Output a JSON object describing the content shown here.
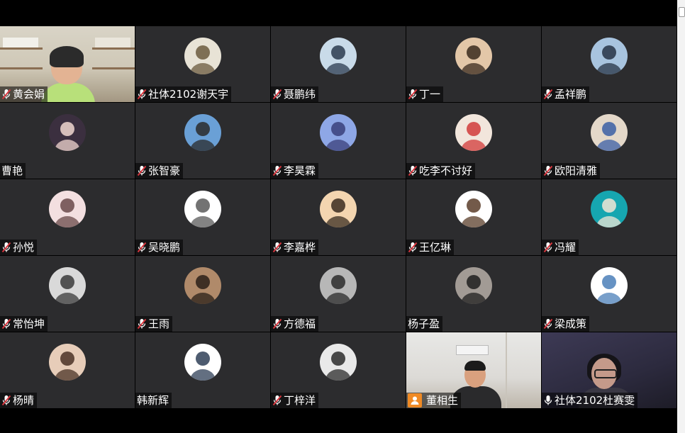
{
  "participants": [
    {
      "name": "黄会娟",
      "mic": "muted",
      "video": "room",
      "avatar": {
        "bg": "#d7d2c6",
        "fg": "#6a5d4a",
        "icon": "photo-icon"
      }
    },
    {
      "name": "社体2102谢天宇",
      "mic": "muted",
      "avatar": {
        "bg": "#e8e3d6",
        "fg": "#6b5a3e",
        "icon": "calligraphy-avatar-icon"
      }
    },
    {
      "name": "聂鹏纬",
      "mic": "muted",
      "avatar": {
        "bg": "#c9dbe9",
        "fg": "#2b3b4f",
        "icon": "person-avatar-icon"
      }
    },
    {
      "name": "丁一",
      "mic": "muted",
      "avatar": {
        "bg": "#e3c7a8",
        "fg": "#3a2a1d",
        "icon": "child-avatar-icon"
      }
    },
    {
      "name": "孟祥鹏",
      "mic": "muted",
      "avatar": {
        "bg": "#a8c4df",
        "fg": "#273446",
        "icon": "building-avatar-icon"
      }
    },
    {
      "name": "曹艳",
      "mic": "none",
      "avatar": {
        "bg": "#3b2f3f",
        "fg": "#f1d7d0",
        "icon": "person-avatar-icon"
      }
    },
    {
      "name": "张智豪",
      "mic": "muted",
      "avatar": {
        "bg": "#6aa0d6",
        "fg": "#2a2a2a",
        "icon": "person-avatar-icon"
      }
    },
    {
      "name": "李昊霖",
      "mic": "muted",
      "avatar": {
        "bg": "#8ea7e6",
        "fg": "#3a3f7a",
        "icon": "cartoon-cat-avatar-icon"
      }
    },
    {
      "name": "吃李不讨好",
      "mic": "muted",
      "avatar": {
        "bg": "#f2e6dc",
        "fg": "#d13a3a",
        "icon": "child-avatar-icon"
      }
    },
    {
      "name": "欧阳清雅",
      "mic": "muted",
      "avatar": {
        "bg": "#e4d8c9",
        "fg": "#3b5fa5",
        "icon": "baby-avatar-icon"
      }
    },
    {
      "name": "孙悦",
      "mic": "muted",
      "avatar": {
        "bg": "#f3dfe0",
        "fg": "#6a4a4a",
        "icon": "person-avatar-icon"
      }
    },
    {
      "name": "吴晓鹏",
      "mic": "muted",
      "avatar": {
        "bg": "#ffffff",
        "fg": "#5a5a5a",
        "icon": "cartoon-wolf-avatar-icon"
      }
    },
    {
      "name": "李嘉桦",
      "mic": "muted",
      "avatar": {
        "bg": "#f3d5b0",
        "fg": "#3a2c20",
        "icon": "cartoon-boy-avatar-icon"
      }
    },
    {
      "name": "王亿琳",
      "mic": "muted",
      "avatar": {
        "bg": "#ffffff",
        "fg": "#5a3d2a",
        "icon": "anime-avatar-icon"
      }
    },
    {
      "name": "冯耀",
      "mic": "muted",
      "avatar": {
        "bg": "#16a6b0",
        "fg": "#f2e6d6",
        "icon": "cat-avatar-icon"
      }
    },
    {
      "name": "常怡坤",
      "mic": "muted",
      "avatar": {
        "bg": "#d9d9d9",
        "fg": "#3a3a3a",
        "icon": "group-photo-avatar-icon"
      }
    },
    {
      "name": "王雨",
      "mic": "muted",
      "avatar": {
        "bg": "#b08a6a",
        "fg": "#2a1f18",
        "icon": "person-avatar-icon"
      }
    },
    {
      "name": "方德福",
      "mic": "muted",
      "avatar": {
        "bg": "#b7b7b7",
        "fg": "#2b2b2b",
        "icon": "shark-avatar-icon"
      }
    },
    {
      "name": "杨子盈",
      "mic": "none",
      "avatar": {
        "bg": "#a29b95",
        "fg": "#1f1f1f",
        "icon": "person-avatar-icon"
      }
    },
    {
      "name": "梁成策",
      "mic": "muted",
      "avatar": {
        "bg": "#ffffff",
        "fg": "#4b7fb8",
        "icon": "fish-avatar-icon"
      }
    },
    {
      "name": "杨晴",
      "mic": "muted",
      "avatar": {
        "bg": "#e7cdb9",
        "fg": "#4a3126",
        "icon": "child-avatar-icon"
      }
    },
    {
      "name": "韩新辉",
      "mic": "none",
      "avatar": {
        "bg": "#ffffff",
        "fg": "#2f3f57",
        "icon": "person-avatar-icon"
      }
    },
    {
      "name": "丁梓洋",
      "mic": "muted",
      "avatar": {
        "bg": "#e9e9e9",
        "fg": "#2b2b2b",
        "icon": "person-avatar-icon"
      }
    },
    {
      "name": "董相生",
      "mic": "host",
      "video": "office"
    },
    {
      "name": "社体2102杜赛雯",
      "mic": "on",
      "video": "dark",
      "active": true
    }
  ],
  "colors": {
    "tile_bg": "#2c2c2e",
    "muted_mic": "#d9363e",
    "host_badge": "#f08a24",
    "active_border": "#2fb67c"
  }
}
